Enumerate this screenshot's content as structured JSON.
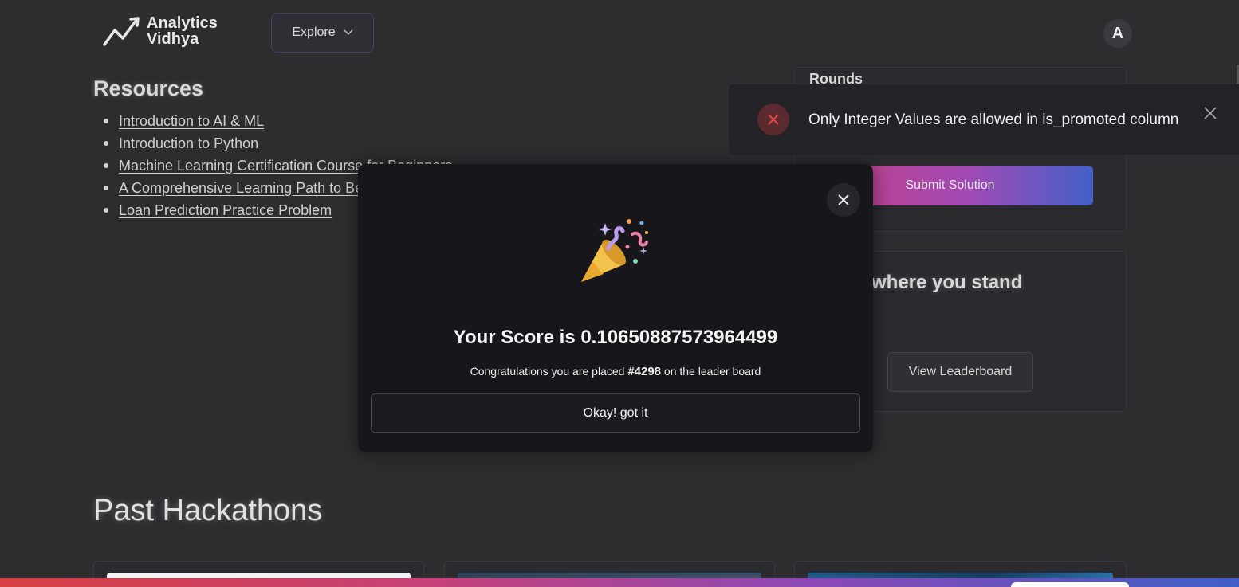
{
  "header": {
    "logo_line1": "Analytics",
    "logo_line2": "Vidhya",
    "explore_label": "Explore",
    "avatar_initial": "A"
  },
  "resources": {
    "title": "Resources",
    "items": [
      "Introduction to AI & ML",
      "Introduction to Python",
      "Machine Learning Certification Course for Beginners",
      "A Comprehensive Learning Path to Become a Data Scientist",
      "Loan Prediction Practice Problem"
    ]
  },
  "rounds": {
    "title": "Rounds",
    "submit_label": "Submit Solution"
  },
  "standing": {
    "title": "where you stand",
    "leaderboard_label": "View Leaderboard"
  },
  "toast": {
    "message": "Only Integer Values are allowed in is_promoted column",
    "icon": "error-x-icon",
    "color": "#e04848"
  },
  "modal": {
    "score_text": "Your Score is 0.10650887573964499",
    "congrats_prefix": "Congratulations you are placed ",
    "rank": "#4298",
    "congrats_suffix": " on the leader board",
    "ok_label": "Okay! got it",
    "icon": "party-popper-icon"
  },
  "past": {
    "title": "Past Hackathons"
  },
  "colors": {
    "background": "#2d2c2f",
    "modal_bg": "#17161a",
    "gradient_start": "#c2407e",
    "gradient_end": "#4360c8"
  }
}
